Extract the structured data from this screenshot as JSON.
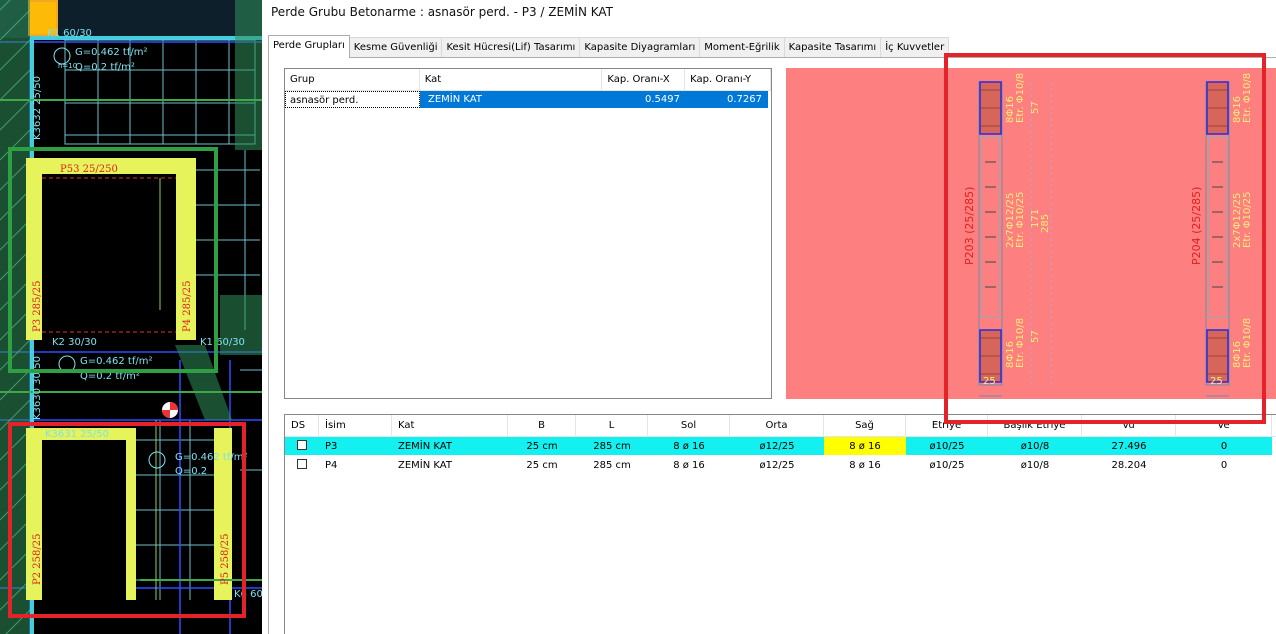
{
  "window": {
    "title": "Perde Grubu Betonarme  :  asnasör perd. - P3 / ZEMİN KAT"
  },
  "tabs": [
    {
      "label": "Perde Grupları",
      "active": true
    },
    {
      "label": "Kesme Güvenliği"
    },
    {
      "label": "Kesit Hücresi(Lif) Tasarımı"
    },
    {
      "label": "Kapasite Diyagramları"
    },
    {
      "label": "Moment-Eğrilik"
    },
    {
      "label": "Kapasite Tasarımı"
    },
    {
      "label": "İç Kuvvetler"
    }
  ],
  "group_table": {
    "headers": [
      "Grup",
      "Kat",
      "Kap. Oranı-X",
      "Kap. Oranı-Y"
    ],
    "rows": [
      {
        "grup": "asnasör perd.",
        "kat": "ZEMİN KAT",
        "kap_x": "0.5497",
        "kap_y": "0.7267",
        "selected": true
      }
    ]
  },
  "wall_table": {
    "headers": [
      "DS",
      "İsim",
      "Kat",
      "B",
      "L",
      "Sol",
      "Orta",
      "Sağ",
      "Etriye",
      "Başlık Etriye",
      "Vu",
      "Ve"
    ],
    "rows": [
      {
        "isim": "P3",
        "kat": "ZEMİN KAT",
        "b": "25 cm",
        "l": "285 cm",
        "sol": "8 ø 16",
        "orta": "ø12/25",
        "sag": "8 ø 16",
        "etriye": "ø10/25",
        "baslik": "ø10/8",
        "vu": "27.496",
        "ve": "0",
        "highlighted": true
      },
      {
        "isim": "P4",
        "kat": "ZEMİN KAT",
        "b": "25 cm",
        "l": "285 cm",
        "sol": "8 ø 16",
        "orta": "ø12/25",
        "sag": "8 ø 16",
        "etriye": "ø10/25",
        "baslik": "ø10/8",
        "vu": "28.204",
        "ve": "0"
      }
    ]
  },
  "preview": {
    "walls": [
      {
        "name": "P203 (25/285)",
        "top_bars": "8Φ16",
        "top_stirrup": "Etr. Φ10/8",
        "mid_bars": "2x7Φ12/25",
        "mid_stirrup": "Etr. Φ10/25",
        "bot_bars": "8Φ16",
        "bot_stirrup": "Etr. Φ10/8",
        "dim_top": "57",
        "dim_mid": "171",
        "dim_total": "285",
        "dim_bot": "57",
        "width": "25"
      },
      {
        "name": "P204 (25/285)",
        "top_bars": "8Φ16",
        "top_stirrup": "Etr. Φ10/8",
        "mid_bars": "2x7Φ12/25",
        "mid_stirrup": "Etr. Φ10/25",
        "bot_bars": "8Φ16",
        "bot_stirrup": "Etr. Φ10/8",
        "dim_top": "57",
        "dim_mid": "171",
        "dim_total": "285",
        "dim_bot": "57",
        "width": "25"
      }
    ]
  },
  "cad": {
    "labels": {
      "k1_top": "K1 60/30",
      "load_g1": "G=0.462 tf/m²",
      "load_q1": "Q=0.2 tf/m²",
      "h1": "h=10",
      "k3632": "K3632 25/50",
      "p53": "P53 25/250",
      "p3": "P3 285/25",
      "p4": "P4 285/25",
      "k2": "K2 30/30",
      "k1_mid": "K1 60/30",
      "load_g2": "G=0.462 tf/m²",
      "load_q2": "Q=0.2 tf/m²",
      "k3630": "K3630 30/50",
      "k3631": "K3631 25/50",
      "load_g3": "G=0.462 tf/m²",
      "load_q3": "Q=0.2",
      "p2": "P2 258/25",
      "p5": "P5 258/25",
      "k6": "K6 60"
    }
  },
  "colors": {
    "highlight_green": "#2ea043",
    "highlight_red": "#e4222a",
    "preview_bg": "#fe7f7f",
    "row_cyan": "#14f0f0",
    "row_yellow": "#ffff00",
    "select_blue": "#0078d7"
  }
}
